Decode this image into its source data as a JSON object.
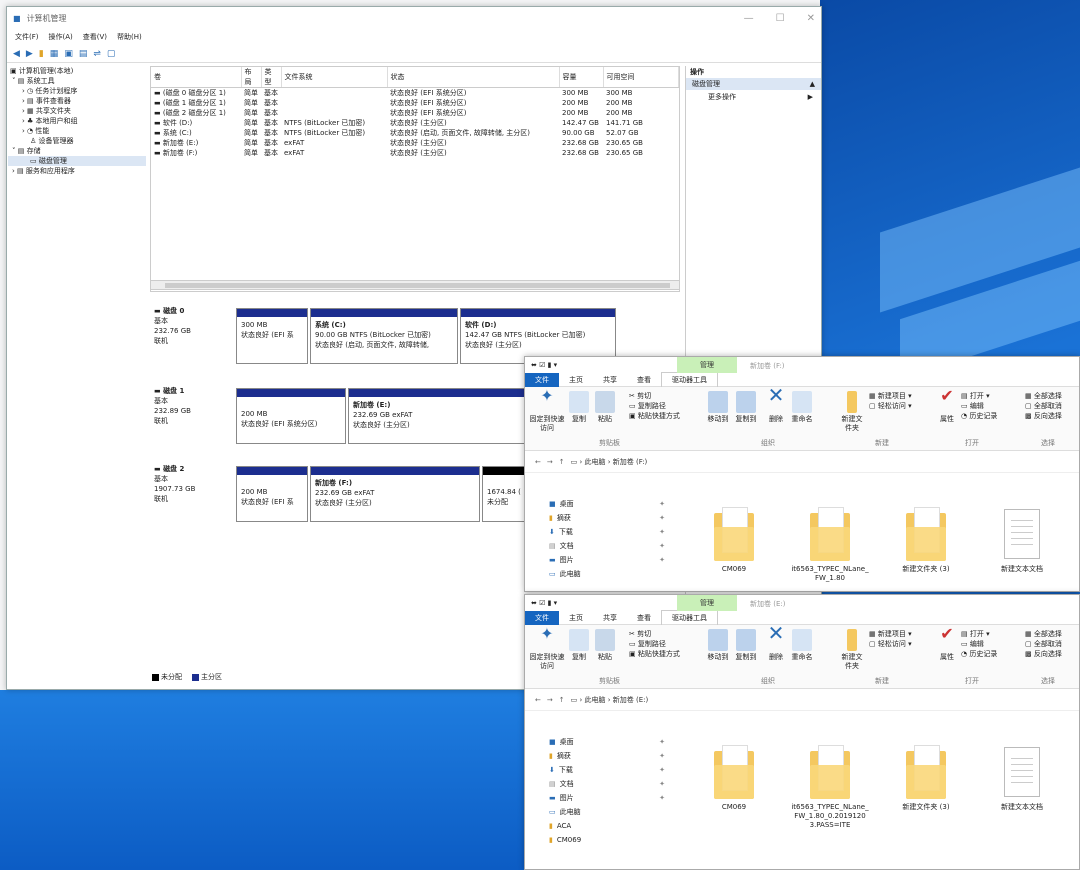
{
  "compmgmt": {
    "title": "计算机管理",
    "menu": [
      "文件(F)",
      "操作(A)",
      "查看(V)",
      "帮助(H)"
    ],
    "tree": [
      {
        "label": "计算机管理(本地)",
        "level": 0
      },
      {
        "label": "系统工具",
        "level": 1
      },
      {
        "label": "任务计划程序",
        "level": 2
      },
      {
        "label": "事件查看器",
        "level": 2
      },
      {
        "label": "共享文件夹",
        "level": 2
      },
      {
        "label": "本地用户和组",
        "level": 2
      },
      {
        "label": "性能",
        "level": 2
      },
      {
        "label": "设备管理器",
        "level": 2
      },
      {
        "label": "存储",
        "level": 1
      },
      {
        "label": "磁盘管理",
        "level": 2
      },
      {
        "label": "服务和应用程序",
        "level": 1
      }
    ],
    "columns": [
      "卷",
      "布局",
      "类型",
      "文件系统",
      "状态",
      "容量",
      "可用空间"
    ],
    "volumes": [
      [
        "(磁盘 0 磁盘分区 1)",
        "简单",
        "基本",
        "",
        "状态良好 (EFI 系统分区)",
        "300 MB",
        "300 MB"
      ],
      [
        "(磁盘 1 磁盘分区 1)",
        "简单",
        "基本",
        "",
        "状态良好 (EFI 系统分区)",
        "200 MB",
        "200 MB"
      ],
      [
        "(磁盘 2 磁盘分区 1)",
        "简单",
        "基本",
        "",
        "状态良好 (EFI 系统分区)",
        "200 MB",
        "200 MB"
      ],
      [
        "软件 (D:)",
        "简单",
        "基本",
        "NTFS (BitLocker 已加密)",
        "状态良好 (主分区)",
        "142.47 GB",
        "141.71 GB"
      ],
      [
        "系统 (C:)",
        "简单",
        "基本",
        "NTFS (BitLocker 已加密)",
        "状态良好 (启动, 页面文件, 故障转储, 主分区)",
        "90.00 GB",
        "52.07 GB"
      ],
      [
        "新加卷 (E:)",
        "简单",
        "基本",
        "exFAT",
        "状态良好 (主分区)",
        "232.68 GB",
        "230.65 GB"
      ],
      [
        "新加卷 (F:)",
        "简单",
        "基本",
        "exFAT",
        "状态良好 (主分区)",
        "232.68 GB",
        "230.65 GB"
      ]
    ],
    "actions": {
      "header": "操作",
      "selected": "磁盘管理",
      "more": "更多操作"
    },
    "disks": [
      {
        "name": "磁盘 0",
        "type": "基本",
        "size": "232.76 GB",
        "status": "联机",
        "parts": [
          {
            "title": "",
            "line1": "300 MB",
            "line2": "状态良好 (EFI 系"
          },
          {
            "title": "系统 (C:)",
            "line1": "90.00 GB NTFS (BitLocker 已加密)",
            "line2": "状态良好 (启动, 页面文件, 故障转储,"
          },
          {
            "title": "软件 (D:)",
            "line1": "142.47 GB NTFS (BitLocker 已加密)",
            "line2": "状态良好 (主分区)"
          }
        ]
      },
      {
        "name": "磁盘 1",
        "type": "基本",
        "size": "232.89 GB",
        "status": "联机",
        "parts": [
          {
            "title": "",
            "line1": "200 MB",
            "line2": "状态良好 (EFI 系统分区)"
          },
          {
            "title": "新加卷 (E:)",
            "line1": "232.69 GB exFAT",
            "line2": "状态良好 (主分区)"
          }
        ]
      },
      {
        "name": "磁盘 2",
        "type": "基本",
        "size": "1907.73 GB",
        "status": "联机",
        "parts": [
          {
            "title": "",
            "line1": "200 MB",
            "line2": "状态良好 (EFI 系"
          },
          {
            "title": "新加卷 (F:)",
            "line1": "232.69 GB exFAT",
            "line2": "状态良好 (主分区)"
          },
          {
            "title": "",
            "line1": "1674.84 (",
            "line2": "未分配"
          }
        ]
      }
    ],
    "legend": [
      "未分配",
      "主分区"
    ]
  },
  "explorer_common": {
    "manage": "管理",
    "tabs": [
      "文件",
      "主页",
      "共享",
      "查看",
      "驱动器工具"
    ],
    "ribbon": {
      "pin": "固定到快速访问",
      "copy": "复制",
      "paste": "粘贴",
      "cut": "剪切",
      "copy_path": "复制路径",
      "paste_shortcut": "粘贴快捷方式",
      "move_to": "移动到",
      "copy_to": "复制到",
      "delete": "删除",
      "rename": "重命名",
      "new_folder": "新建文件夹",
      "new_item": "新建项目",
      "easy_access": "轻松访问",
      "properties": "属性",
      "open": "打开",
      "edit": "编辑",
      "history": "历史记录",
      "select_all": "全部选择",
      "select_none": "全部取消",
      "invert": "反向选择",
      "grp_clipboard": "剪贴板",
      "grp_organize": "组织",
      "grp_new": "新建",
      "grp_open": "打开",
      "grp_select": "选择"
    },
    "this_pc": "此电脑"
  },
  "explorer_f": {
    "title_path": "新加卷 (F:)",
    "drive": "新加卷 (F:)",
    "nav": [
      "桌面",
      "摘获",
      "下载",
      "文档",
      "图片",
      "此电脑"
    ],
    "files": [
      {
        "name": "CM069",
        "kind": "folder"
      },
      {
        "name": "it6563_TYPEC_NLane_FW_1.80",
        "kind": "folder"
      },
      {
        "name": "新建文件夹 (3)",
        "kind": "folder"
      },
      {
        "name": "新建文本文档",
        "kind": "doc"
      }
    ]
  },
  "explorer_e": {
    "title_path": "新加卷 (E:)",
    "drive": "新加卷 (E:)",
    "nav": [
      "桌面",
      "摘获",
      "下载",
      "文档",
      "图片",
      "此电脑",
      "ACA",
      "CM069"
    ],
    "files": [
      {
        "name": "CM069",
        "kind": "folder"
      },
      {
        "name": "it6563_TYPEC_NLane_FW_1.80_0.20191203.PASS=ITE",
        "kind": "folder"
      },
      {
        "name": "新建文件夹 (3)",
        "kind": "folder"
      },
      {
        "name": "新建文本文档",
        "kind": "doc"
      }
    ]
  }
}
